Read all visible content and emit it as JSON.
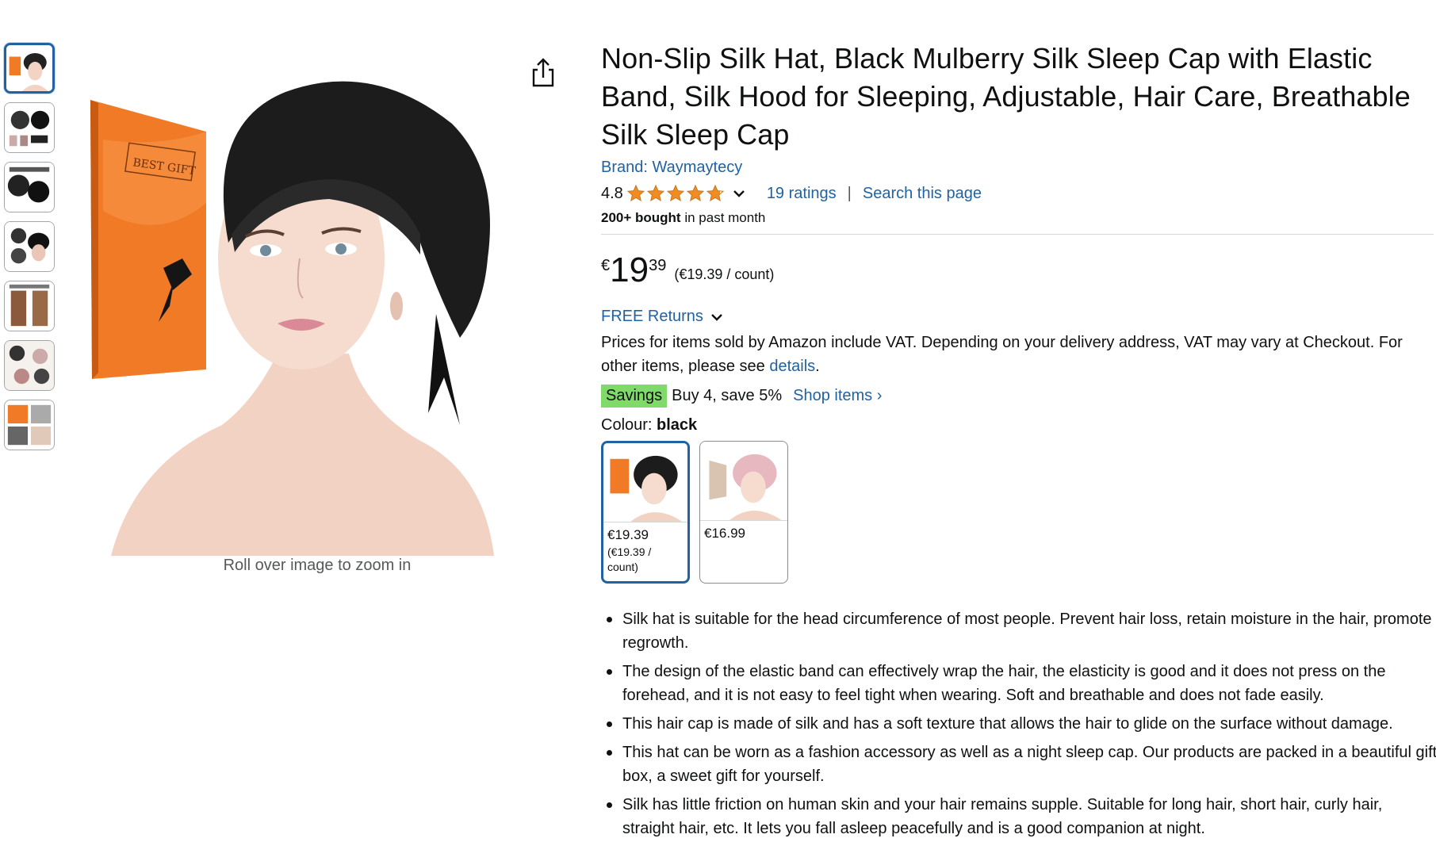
{
  "gallery": {
    "thumbnails": [
      {
        "icon": "product-model-thumbnail",
        "active": true
      },
      {
        "icon": "product-detail-thumbnail"
      },
      {
        "icon": "product-features-thumbnail"
      },
      {
        "icon": "product-sizes-thumbnail"
      },
      {
        "icon": "protect-hair-thumbnail"
      },
      {
        "icon": "product-collage-thumbnail"
      },
      {
        "icon": "product-lifestyle-thumbnail"
      }
    ],
    "main_image_box_text": "BEST GIFT",
    "zoom_hint": "Roll over image to zoom in",
    "share_icon": "share-icon"
  },
  "product": {
    "title": "Non-Slip Silk Hat, Black Mulberry Silk Sleep Cap with Elastic Band, Silk Hood for Sleeping, Adjustable, Hair Care, Breathable Silk Sleep Cap",
    "brand": "Brand: Waymaytecy",
    "rating": "4.8",
    "rating_stars": 4.8,
    "ratings_count": "19 ratings",
    "search_page": "Search this page",
    "separator": "|",
    "bought_bold": "200+ bought",
    "bought_rest": " in past month"
  },
  "price": {
    "symbol": "€",
    "whole": "19",
    "fraction": "39",
    "unit": "(€19.39 / count)",
    "returns": "FREE Returns",
    "vat_text": "Prices for items sold by Amazon include VAT. Depending on your delivery address, VAT may vary at Checkout. For other items, please see ",
    "vat_link": "details",
    "vat_end": ".",
    "savings_badge": "Savings",
    "savings_text": "Buy 4, save 5%",
    "shop_items": "Shop items ›"
  },
  "colour": {
    "label": "Colour: ",
    "selected": "black",
    "options": [
      {
        "name": "black",
        "price": "€19.39",
        "unit": "(€19.39 / count)",
        "active": true
      },
      {
        "name": "pink",
        "price": "€16.99",
        "unit": ""
      }
    ]
  },
  "bullets": [
    "Silk hat is suitable for the head circumference of most people. Prevent hair loss, retain moisture in the hair, promote regrowth.",
    "The design of the elastic band can effectively wrap the hair, the elasticity is good and it does not press on the forehead, and it is not easy to feel tight when wearing. Soft and breathable and does not fade easily.",
    "This hair cap is made of silk and has a soft texture that allows the hair to glide on the surface without damage.",
    "This hat can be worn as a fashion accessory as well as a night sleep cap. Our products are packed in a beautiful gift box, a sweet gift for yourself.",
    "Silk has little friction on human skin and your hair remains supple. Suitable for long hair, short hair, curly hair, straight hair, etc. It lets you fall asleep peacefully and is a good companion at night."
  ],
  "colors": {
    "link": "#2162a1",
    "text": "#0f1111",
    "savings_badge": "#7fda69",
    "star": "#f08c23",
    "selected_border": "#2162a1"
  }
}
